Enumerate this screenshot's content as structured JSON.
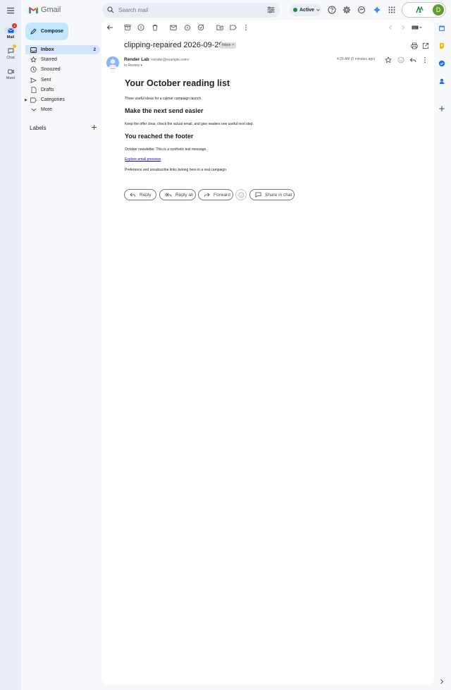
{
  "app": {
    "name": "Gmail"
  },
  "rail": {
    "items": [
      {
        "label": "Mail",
        "badge": "2"
      },
      {
        "label": "Chat"
      },
      {
        "label": "Meet"
      }
    ]
  },
  "search": {
    "placeholder": "Search mail"
  },
  "status": {
    "label": "Active"
  },
  "account": {
    "initial": "D"
  },
  "compose": {
    "label": "Compose"
  },
  "nav": {
    "items": [
      {
        "label": "Inbox",
        "count": "2"
      },
      {
        "label": "Starred"
      },
      {
        "label": "Snoozed"
      },
      {
        "label": "Sent"
      },
      {
        "label": "Drafts"
      },
      {
        "label": "Categories"
      },
      {
        "label": "More"
      }
    ],
    "labels_heading": "Labels"
  },
  "message": {
    "subject": "clipping-repaired 2026-09-29",
    "chip": "Inbox",
    "sender_name": "Render Lab",
    "sender_email": "<render@example.com>",
    "to": "to Review",
    "time": "4:26 AM (0 minutes ago)",
    "body": {
      "title": "Your October reading list",
      "p1": "Three useful ideas for a calmer campaign launch.",
      "h2": "Make the next send easier",
      "p2": "Keep the offer clear, check the actual email, and give readers one useful next step.",
      "h3": "You reached the footer",
      "p3": "October newsletter. This is a synthetic test message.",
      "link": "Explore email previews",
      "p4": "Preference and unsubscribe links belong here in a real campaign."
    }
  },
  "actions": {
    "reply": "Reply",
    "reply_all": "Reply all",
    "forward": "Forward",
    "share": "Share in chat"
  },
  "colors": {
    "rail_bg": "#e9eef6",
    "compose_bg": "#c2e7ff",
    "active_nav": "#d3e3fd",
    "link": "#1a0dab"
  }
}
